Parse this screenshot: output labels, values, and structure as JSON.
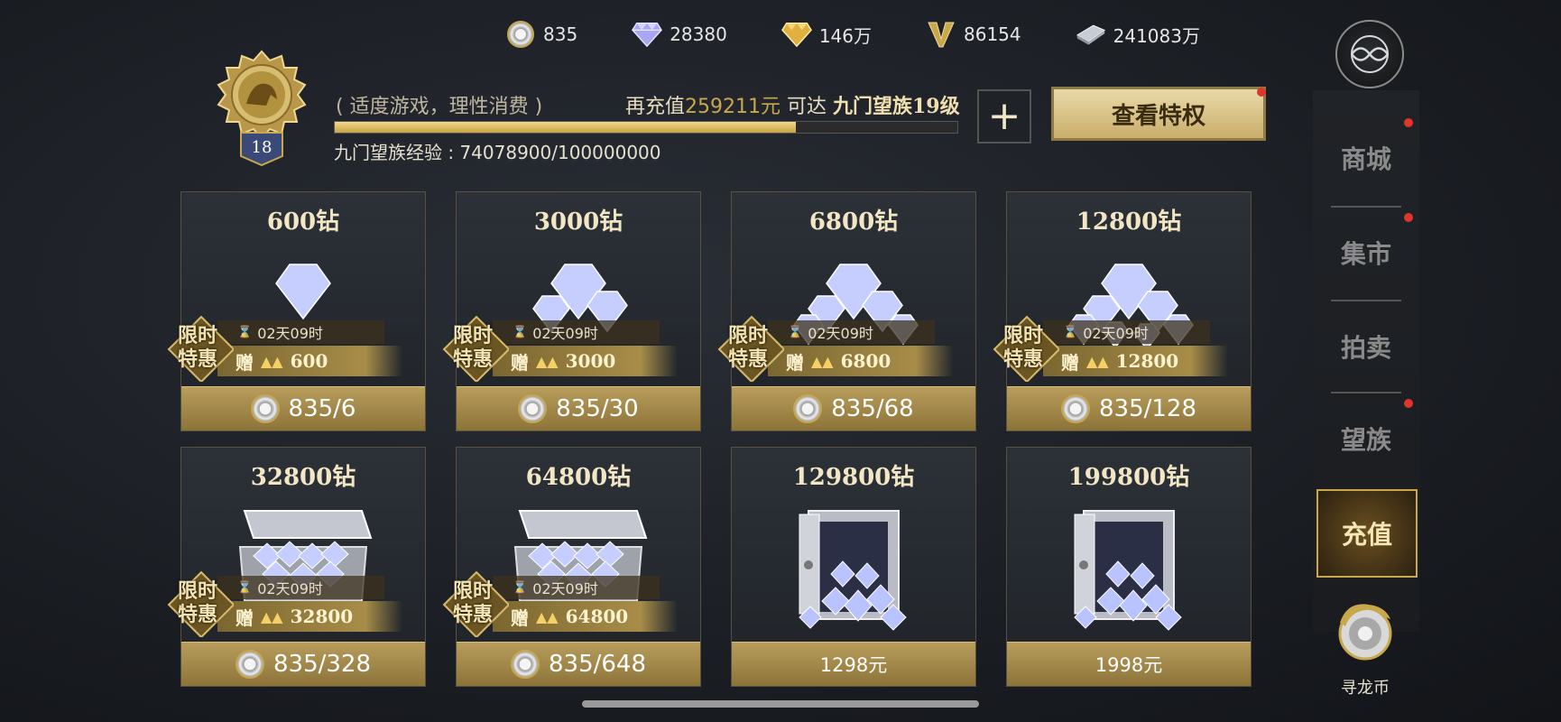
{
  "currencies": [
    {
      "icon": "dragon-coin-icon",
      "value": "835"
    },
    {
      "icon": "diamond-icon",
      "value": "28380"
    },
    {
      "icon": "gold-diamond-icon",
      "value": "146万"
    },
    {
      "icon": "v-point-icon",
      "value": "86154"
    },
    {
      "icon": "silver-ingot-icon",
      "value": "241083万"
    }
  ],
  "vip": {
    "level": "18",
    "hint": "( 适度游戏，理性消费 )",
    "need_prefix": "再充值",
    "need_amount": "259211元",
    "need_mid": " 可达 ",
    "next_level": "九门望族19级",
    "exp_text": "九门望族经验 : 74078900/100000000",
    "exp_progress": 0.740789,
    "privilege_button": "查看特权",
    "plus_button": "+"
  },
  "cards": [
    {
      "title": "600钻",
      "timer": "02天09时",
      "bonus_prefix": "赠",
      "bonus": "600",
      "tag": [
        "限时",
        "特惠"
      ],
      "price": "835/6",
      "coin": true
    },
    {
      "title": "3000钻",
      "timer": "02天09时",
      "bonus_prefix": "赠",
      "bonus": "3000",
      "tag": [
        "限时",
        "特惠"
      ],
      "price": "835/30",
      "coin": true
    },
    {
      "title": "6800钻",
      "timer": "02天09时",
      "bonus_prefix": "赠",
      "bonus": "6800",
      "tag": [
        "限时",
        "特惠"
      ],
      "price": "835/68",
      "coin": true
    },
    {
      "title": "12800钻",
      "timer": "02天09时",
      "bonus_prefix": "赠",
      "bonus": "12800",
      "tag": [
        "限时",
        "特惠"
      ],
      "price": "835/128",
      "coin": true
    },
    {
      "title": "32800钻",
      "timer": "02天09时",
      "bonus_prefix": "赠",
      "bonus": "32800",
      "tag": [
        "限时",
        "特惠"
      ],
      "price": "835/328",
      "coin": true
    },
    {
      "title": "64800钻",
      "timer": "02天09时",
      "bonus_prefix": "赠",
      "bonus": "64800",
      "tag": [
        "限时",
        "特惠"
      ],
      "price": "835/648",
      "coin": true
    },
    {
      "title": "129800钻",
      "price": "1298元",
      "coin": false
    },
    {
      "title": "199800钻",
      "price": "1998元",
      "coin": false
    }
  ],
  "sidebar": {
    "items": [
      {
        "label": "商城",
        "dot": true
      },
      {
        "label": "集市",
        "dot": true
      },
      {
        "label": "拍卖",
        "dot": false
      },
      {
        "label": "望族",
        "dot": true
      },
      {
        "label": "充值",
        "active": true
      }
    ],
    "dragon_label": "寻龙币"
  },
  "colors": {
    "accent_gold": "#c9a84c",
    "red_dot": "#e0352b",
    "panel": "#2c3138"
  }
}
